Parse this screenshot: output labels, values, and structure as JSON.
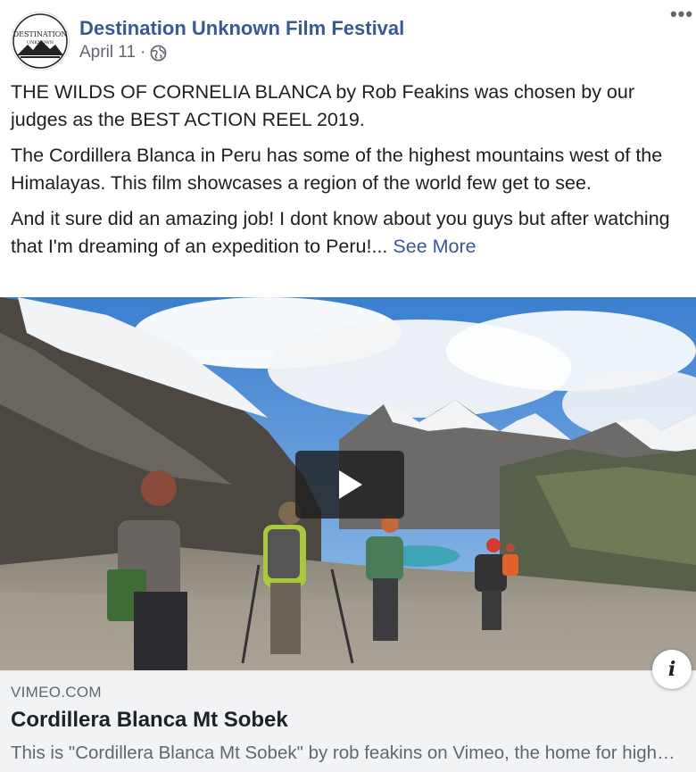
{
  "post": {
    "page_name": "Destination Unknown Film Festival",
    "avatar": {
      "logo_text": "DESTINATION",
      "logo_subtext": "UNKNOWN"
    },
    "date": "April 11",
    "separator": "·",
    "audience_icon": "globe-icon",
    "more_icon": "more-options-icon",
    "more_glyph": "•••",
    "paragraphs": [
      "THE WILDS OF CORNELIA BLANCA by Rob Feakins was chosen by our judges as the BEST ACTION REEL 2019.",
      "The Cordillera Blanca in Peru has some of the highest mountains west of the Himalayas. This film showcases a region of the world few get to see.",
      "And it sure did an amazing job! I dont know about you guys but after watching that I'm dreaming of an expedition to Peru!..."
    ],
    "see_more": "See More"
  },
  "video": {
    "play_icon": "play-icon",
    "info_icon": "info-icon",
    "info_glyph": "i"
  },
  "link_preview": {
    "domain": "VIMEO.COM",
    "title": "Cordillera Blanca Mt Sobek",
    "description": "This is \"Cordillera Blanca Mt Sobek\" by rob feakins on Vimeo, the home for high quality videos and the people who love them."
  },
  "colors": {
    "link_blue": "#385898",
    "meta_gray": "#606770",
    "card_bg": "#f2f3f5",
    "text": "#1c1e21"
  }
}
